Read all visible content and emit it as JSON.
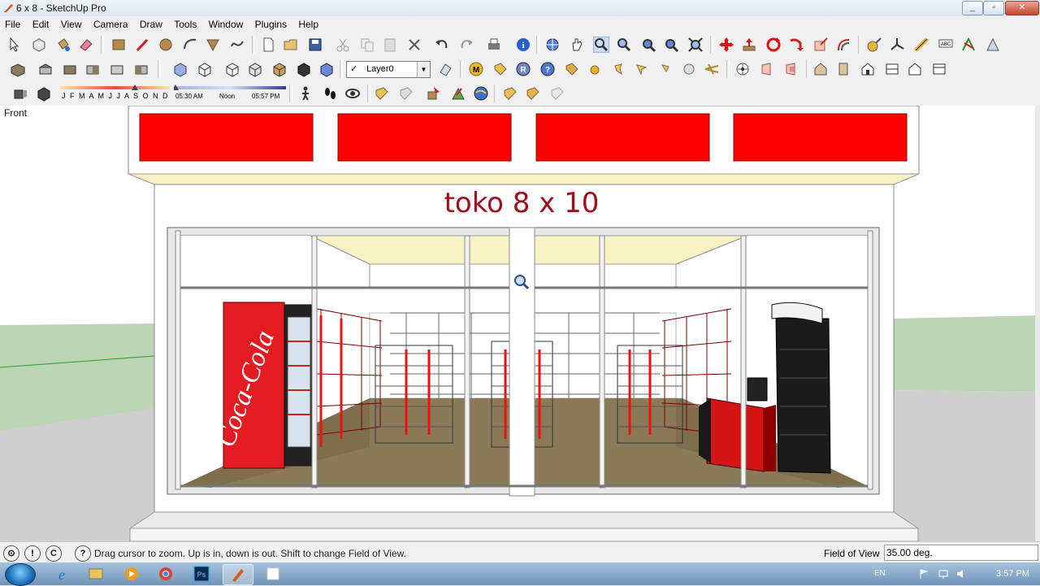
{
  "window": {
    "title": "6 x 8 - SketchUp Pro",
    "minimize": "_",
    "maximize": "▫",
    "close": "✕"
  },
  "menu": [
    "File",
    "Edit",
    "View",
    "Camera",
    "Draw",
    "Tools",
    "Window",
    "Plugins",
    "Help"
  ],
  "toolbar": {
    "layer_value": "Layer0",
    "layer_checkmark": "✓",
    "shadow_months": "J F M A M J J A S O N D",
    "shadow_time_start": "05:30 AM",
    "shadow_time_noon": "Noon",
    "shadow_time_end": "05:57 PM"
  },
  "viewport": {
    "view_label": "Front",
    "store_sign": "toko 8 x 10",
    "colors": {
      "sky": "#ffffff",
      "grass": "#bcd5b4",
      "ground": "#cfcfcf",
      "sign_red": "#ff0000",
      "text_red": "#a10f1a",
      "floor": "#8b7a57",
      "ceiling": "#f7f3c5"
    }
  },
  "statusbar": {
    "message": "Drag cursor to zoom.  Up is in, down is out. Shift to change Field of View.",
    "fov_label": "Field of View",
    "fov_value": "35.00 deg.",
    "help_icon": "?",
    "geo_icon": "⊙",
    "credits_icon": "!",
    "copyright_icon": "C"
  },
  "taskbar": {
    "language": "EN",
    "clock": "3:57 PM"
  }
}
